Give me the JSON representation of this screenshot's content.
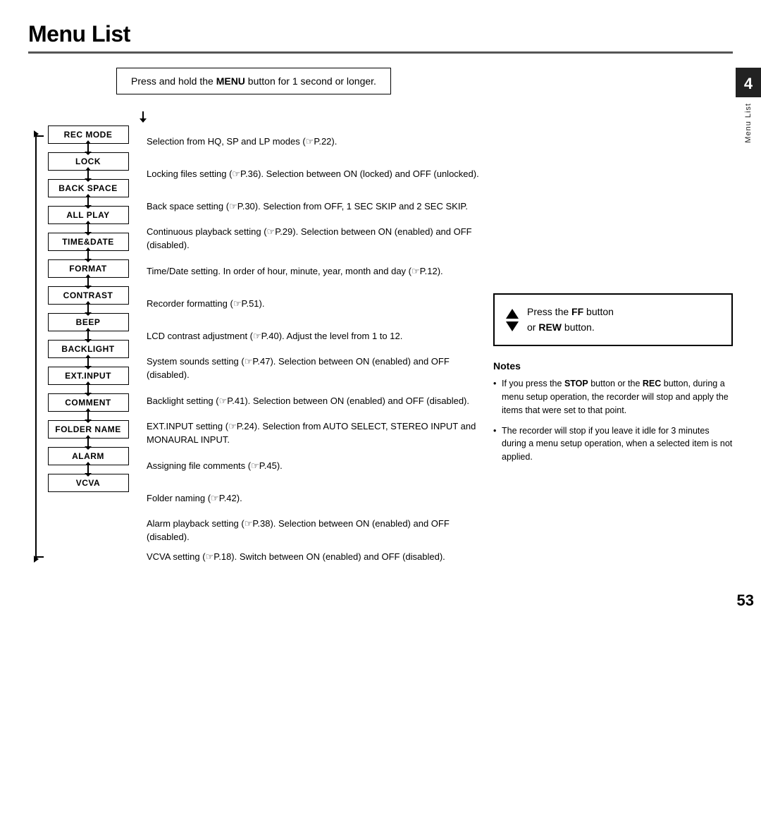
{
  "page": {
    "title": "Menu List",
    "chapter_number": "4",
    "chapter_label": "Menu List",
    "page_number": "53",
    "press_hold_text_pre": "Press and hold the ",
    "press_hold_bold": "MENU",
    "press_hold_text_post": " button for 1 second or longer.",
    "ff_rew_text_pre": "Press the ",
    "ff_rew_ff": "FF",
    "ff_rew_text_mid": " button\nor ",
    "ff_rew_rew": "REW",
    "ff_rew_text_post": " button.",
    "notes_title": "Notes",
    "notes": [
      "If you press the STOP button or the REC button, during a menu setup operation, the recorder will stop and apply the items that were set to that point.",
      "The recorder will stop if you leave it idle for 3 minutes during a menu setup operation, when a selected item is not applied."
    ],
    "notes_bold_1": "STOP",
    "notes_bold_2": "REC",
    "menu_items": [
      {
        "label": "REC MODE",
        "description": "Selection from HQ, SP and LP modes (☞P.22)."
      },
      {
        "label": "LOCK",
        "description": "Locking files setting (☞P.36). Selection between ON (locked) and OFF (unlocked)."
      },
      {
        "label": "BACK SPACE",
        "description": "Back space setting (☞P.30). Selection from OFF, 1 SEC SKIP and 2 SEC SKIP."
      },
      {
        "label": "ALL PLAY",
        "description": "Continuous playback setting (☞P.29). Selection between ON (enabled) and OFF (disabled)."
      },
      {
        "label": "TIME&DATE",
        "description": "Time/Date setting. In order of hour, minute, year, month and day (☞P.12)."
      },
      {
        "label": "FORMAT",
        "description": "Recorder formatting (☞P.51)."
      },
      {
        "label": "CONTRAST",
        "description": "LCD contrast adjustment (☞P.40). Adjust the level from 1 to 12."
      },
      {
        "label": "BEEP",
        "description": "System sounds setting (☞P.47). Selection between ON (enabled) and OFF (disabled)."
      },
      {
        "label": "BACKLIGHT",
        "description": "Backlight setting (☞P.41). Selection between ON (enabled) and OFF (disabled)."
      },
      {
        "label": "EXT.INPUT",
        "description": "EXT.INPUT setting (☞P.24). Selection from AUTO SELECT, STEREO INPUT and MONAURAL INPUT."
      },
      {
        "label": "COMMENT",
        "description": "Assigning file comments (☞P.45)."
      },
      {
        "label": "FOLDER NAME",
        "description": "Folder naming (☞P.42)."
      },
      {
        "label": "ALARM",
        "description": "Alarm playback setting (☞P.38). Selection between ON (enabled) and OFF (disabled)."
      },
      {
        "label": "VCVA",
        "description": "VCVA setting (☞P.18). Switch between ON (enabled) and OFF (disabled)."
      }
    ]
  }
}
